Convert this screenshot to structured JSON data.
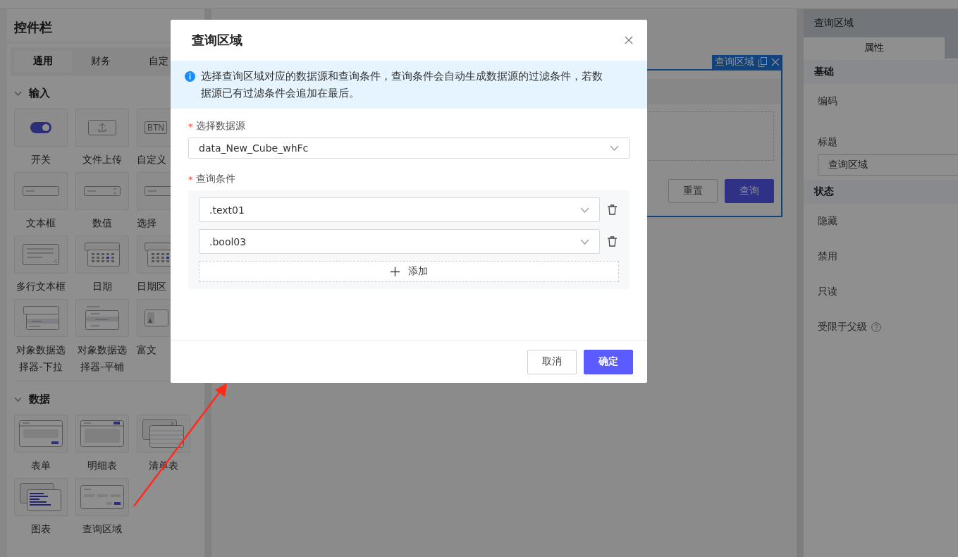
{
  "sidebar": {
    "title": "控件栏",
    "tabs": [
      {
        "label": "通用",
        "selected": true
      },
      {
        "label": "财务",
        "selected": false
      },
      {
        "label": "自定",
        "selected": false
      }
    ],
    "sections": [
      {
        "title": "输入",
        "expanded": true,
        "items": [
          {
            "label": "开关",
            "kind": "switch"
          },
          {
            "label": "文件上传",
            "kind": "upload"
          },
          {
            "label": "自定义",
            "kind": "button",
            "icon_text": "BTN"
          },
          {
            "label": "文本框",
            "kind": "textbox"
          },
          {
            "label": "数值",
            "kind": "number"
          },
          {
            "label": "选择",
            "kind": "textbox"
          },
          {
            "label": "多行文本框",
            "kind": "textarea"
          },
          {
            "label": "日期",
            "kind": "date"
          },
          {
            "label": "日期区",
            "kind": "date"
          },
          {
            "label": "对象数据选择器-下拉",
            "kind": "dropdown"
          },
          {
            "label": "对象数据选择器-平铺",
            "kind": "tiled"
          },
          {
            "label": "富文",
            "kind": "richtext"
          }
        ]
      },
      {
        "title": "数据",
        "expanded": true,
        "items": [
          {
            "label": "表单",
            "kind": "form"
          },
          {
            "label": "明细表",
            "kind": "detail"
          },
          {
            "label": "清单表",
            "kind": "list"
          },
          {
            "label": "图表",
            "kind": "chart"
          },
          {
            "label": "查询区域",
            "kind": "query"
          }
        ]
      }
    ]
  },
  "canvas": {
    "component": {
      "tag": "查询区域",
      "selected": true,
      "buttons": [
        {
          "label": "重置",
          "primary": false
        },
        {
          "label": "查询",
          "primary": true
        }
      ]
    }
  },
  "properties": {
    "title": "查询区域",
    "tabs": [
      {
        "label": "属性",
        "selected": true
      }
    ],
    "sections": [
      {
        "title": "基础",
        "fields": [
          {
            "label": "编码"
          },
          {
            "label": "标题",
            "value": "查询区域"
          }
        ]
      },
      {
        "title": "状态",
        "fields": [
          {
            "label": "隐藏"
          },
          {
            "label": "禁用"
          },
          {
            "label": "只读"
          },
          {
            "label": "受限于父级",
            "help": true
          }
        ]
      }
    ]
  },
  "modal": {
    "title": "查询区域",
    "notice": "选择查询区域对应的数据源和查询条件，查询条件会自动生成数据源的过滤条件，若数据源已有过滤条件会追加在最后。",
    "datasource": {
      "label": "选择数据源",
      "required_mark": "*",
      "value": "data_New_Cube_whFc"
    },
    "conditions": {
      "label": "查询条件",
      "required_mark": "*",
      "items": [
        {
          "value": ".text01"
        },
        {
          "value": ".bool03"
        }
      ],
      "add_label": "添加"
    },
    "buttons": [
      {
        "label": "取消",
        "primary": false
      },
      {
        "label": "确定",
        "primary": true
      }
    ]
  }
}
